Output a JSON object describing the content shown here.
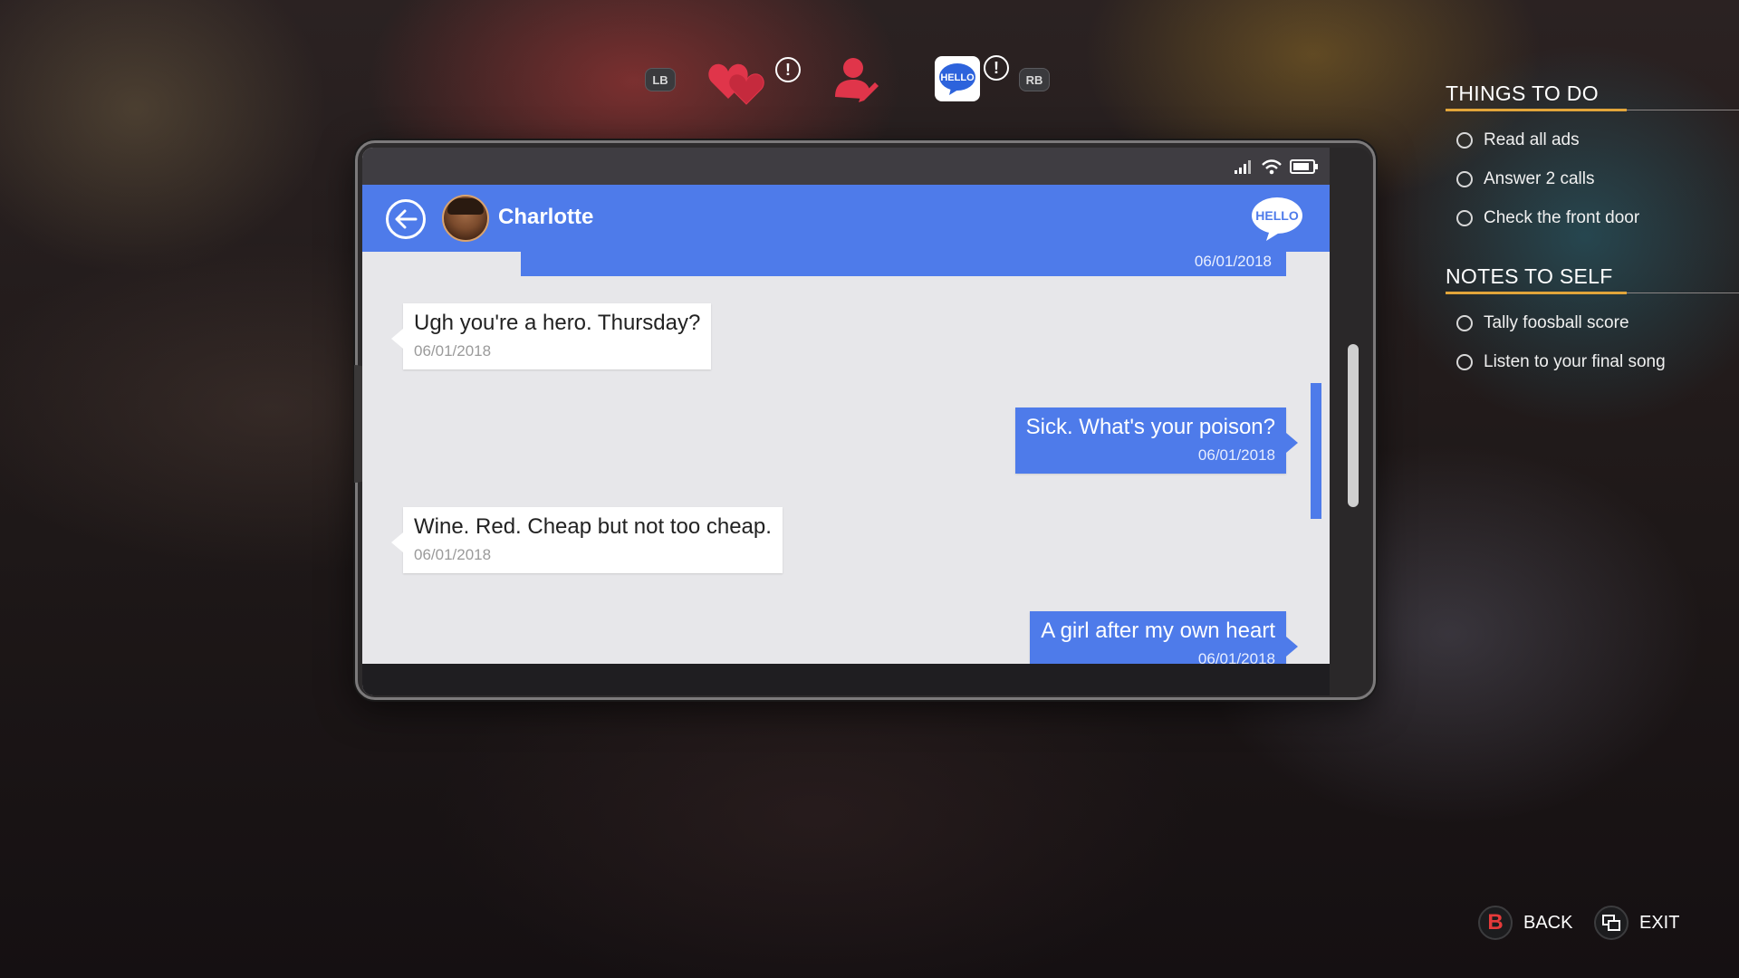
{
  "tabbar": {
    "left_bumper": "LB",
    "right_bumper": "RB",
    "tabs": [
      {
        "icon": "hearts-icon",
        "alert": "!"
      },
      {
        "icon": "contacts-icon"
      },
      {
        "icon": "hello-messages-icon",
        "label": "HELLO",
        "alert": "!",
        "selected": true
      }
    ]
  },
  "phone": {
    "contact_name": "Charlotte",
    "header_badge": "HELLO",
    "previous_message_date": "06/01/2018",
    "messages": [
      {
        "direction": "in",
        "text": "Ugh you're a hero. Thursday?",
        "date": "06/01/2018"
      },
      {
        "direction": "out",
        "text": "Sick. What's your poison?",
        "date": "06/01/2018"
      },
      {
        "direction": "in",
        "text": "Wine. Red. Cheap but not too cheap.",
        "date": "06/01/2018"
      },
      {
        "direction": "out",
        "text": "A girl after my own heart",
        "date": "06/01/2018"
      }
    ]
  },
  "panel": {
    "things_to_do": {
      "title": "THINGS TO DO",
      "items": [
        "Read all ads",
        "Answer 2 calls",
        "Check the front door"
      ]
    },
    "notes_to_self": {
      "title": "NOTES TO SELF",
      "items": [
        "Tally foosball score",
        "Listen to your final song"
      ]
    }
  },
  "controls": {
    "back_button": "B",
    "back_label": "BACK",
    "exit_label": "EXIT"
  },
  "colors": {
    "accent_blue": "#4e7bea",
    "heading_underline": "#e2a53a",
    "tab_red": "#e0354a"
  }
}
